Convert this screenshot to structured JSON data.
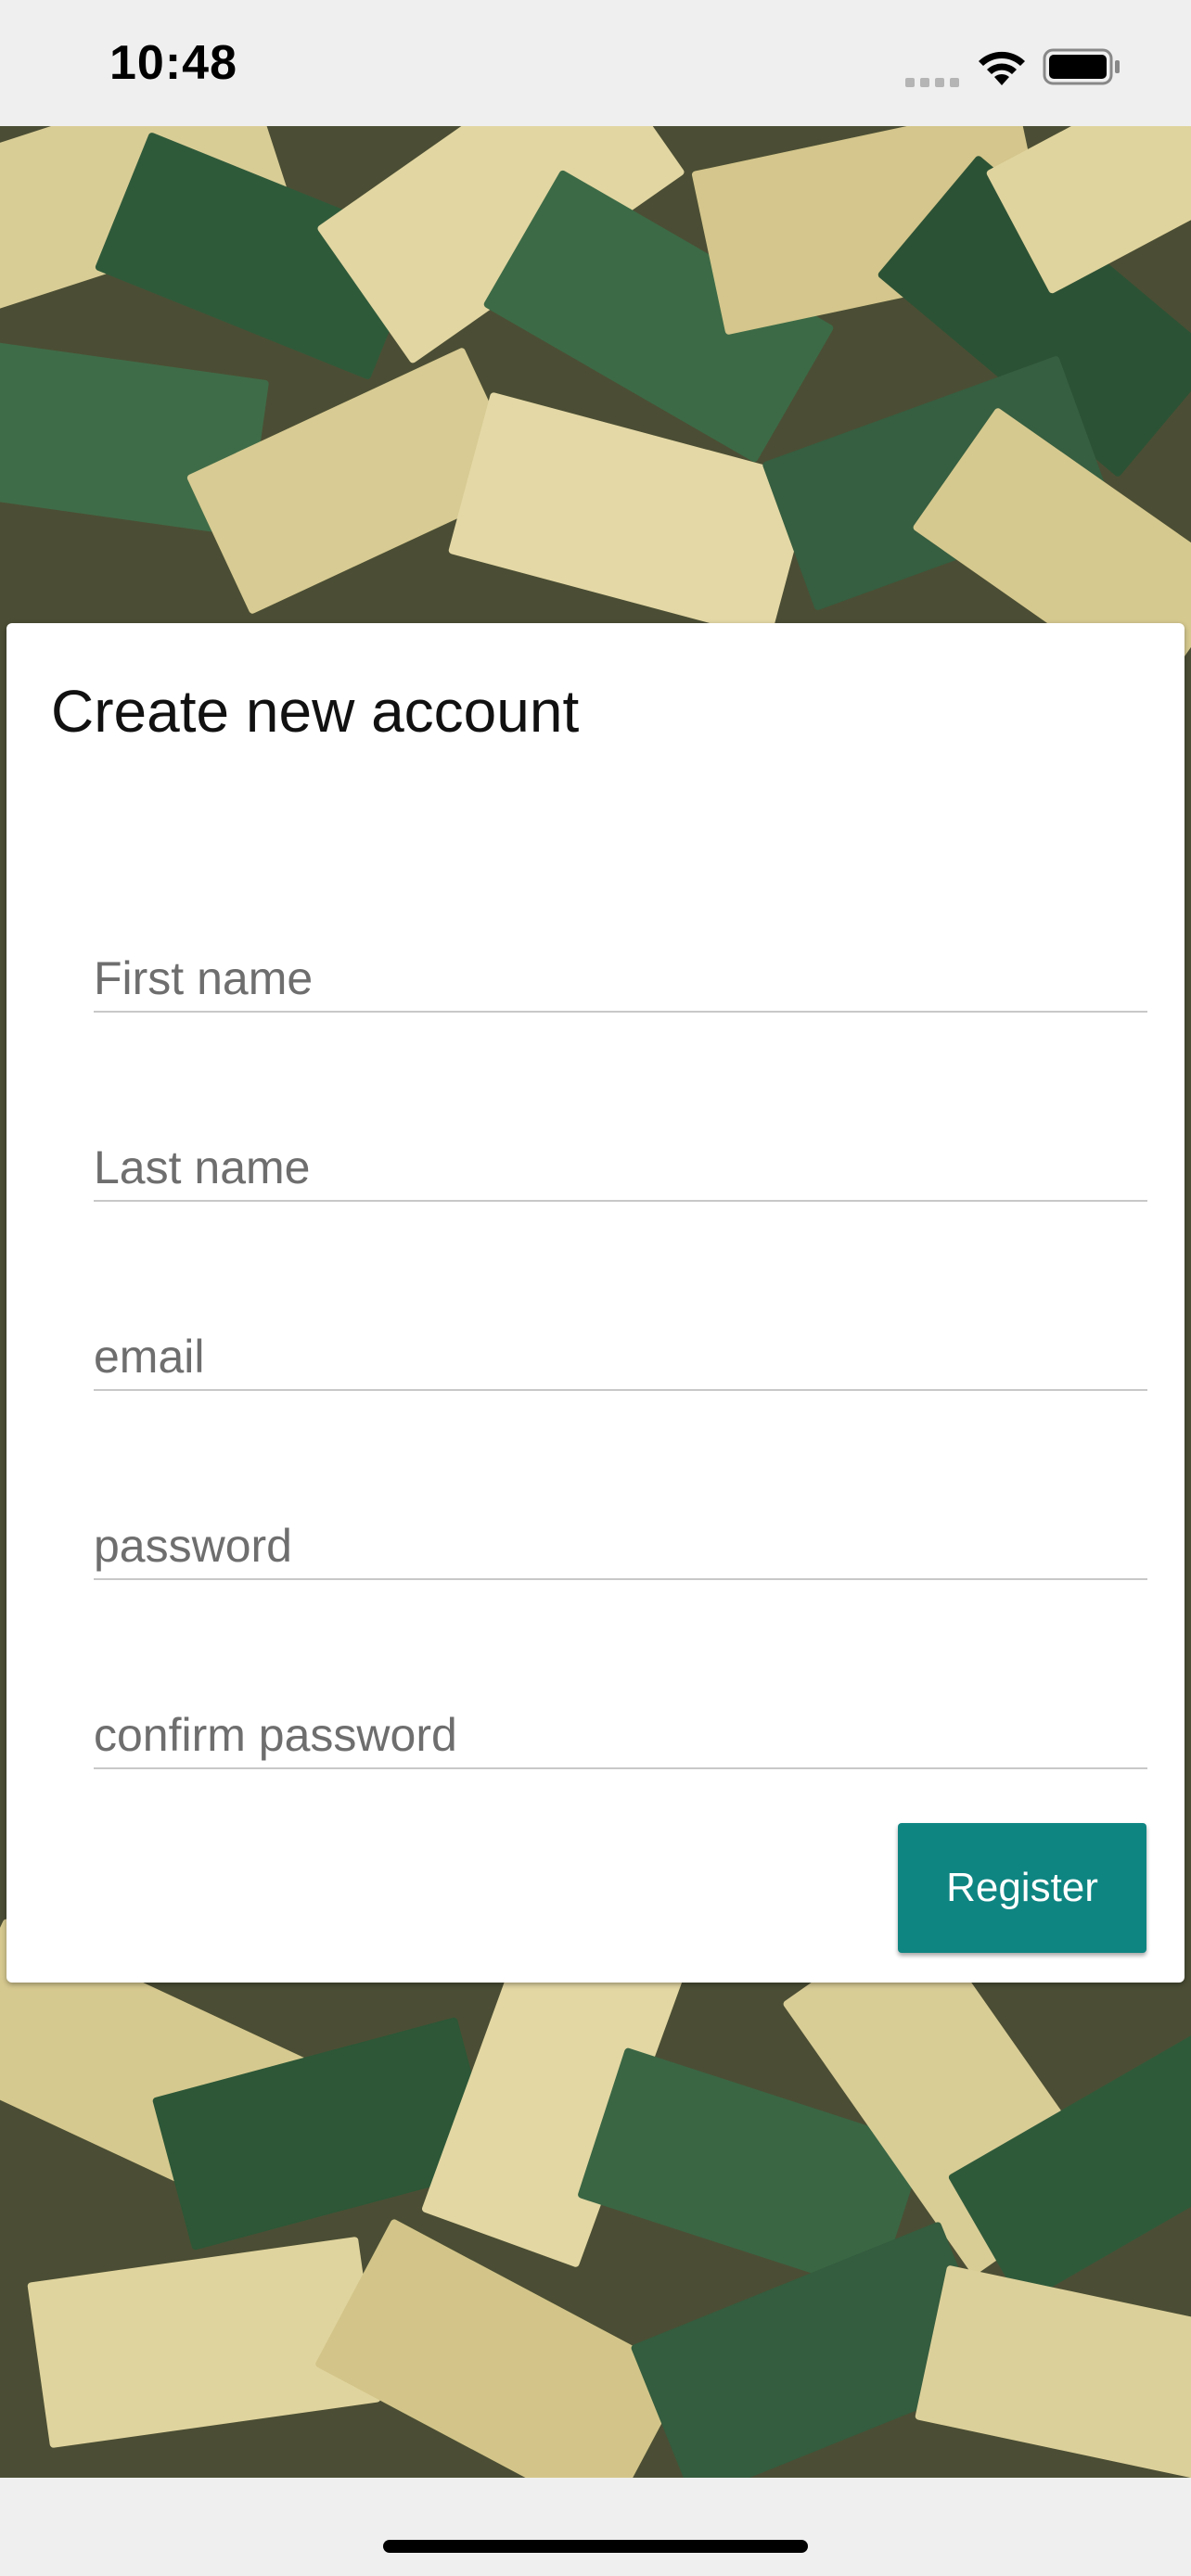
{
  "status_bar": {
    "time": "10:48"
  },
  "form": {
    "title": "Create new account",
    "fields": [
      {
        "placeholder": "First name",
        "value": ""
      },
      {
        "placeholder": "Last name",
        "value": ""
      },
      {
        "placeholder": "email",
        "value": ""
      },
      {
        "placeholder": "password",
        "value": ""
      },
      {
        "placeholder": "confirm password",
        "value": ""
      }
    ],
    "register_label": "Register"
  },
  "colors": {
    "accent": "#0f8582",
    "card": "#ffffff",
    "status_bar_bg": "#efefef"
  },
  "icons": {
    "signal": "cellular-signal-icon",
    "wifi": "wifi-icon",
    "battery": "battery-icon"
  }
}
